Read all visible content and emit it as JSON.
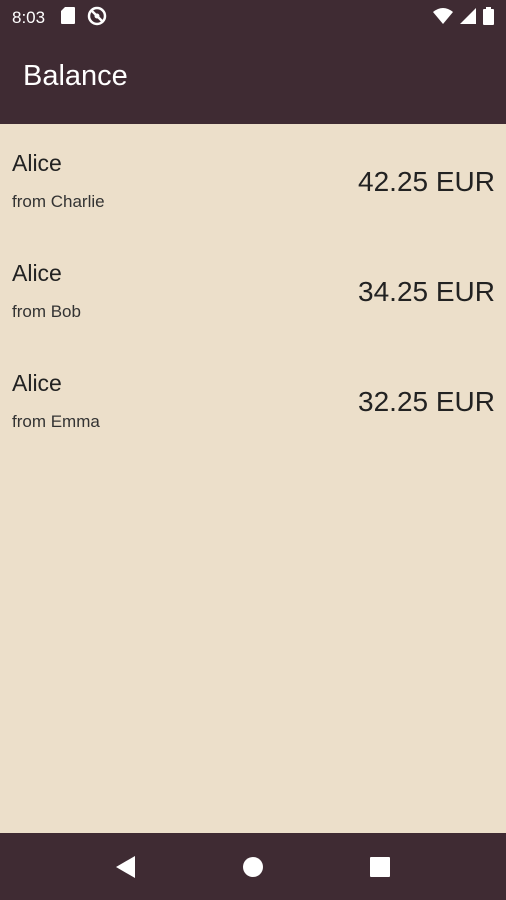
{
  "status_bar": {
    "time": "8:03",
    "icons_left": [
      "sd-card-icon",
      "do-not-disturb-icon"
    ],
    "icons_right": [
      "wifi-icon",
      "signal-icon",
      "battery-icon"
    ]
  },
  "app_bar": {
    "title": "Balance"
  },
  "balances": [
    {
      "name": "Alice",
      "subtitle": "from Charlie",
      "amount": "42.25 EUR"
    },
    {
      "name": "Alice",
      "subtitle": "from Bob",
      "amount": "34.25 EUR"
    },
    {
      "name": "Alice",
      "subtitle": "from Emma",
      "amount": "32.25 EUR"
    }
  ],
  "nav_bar": {
    "buttons": [
      "back-icon",
      "home-icon",
      "recents-icon"
    ]
  },
  "colors": {
    "bar_background": "#3f2b33",
    "page_background": "#ecdfca",
    "text_primary": "#222222"
  }
}
